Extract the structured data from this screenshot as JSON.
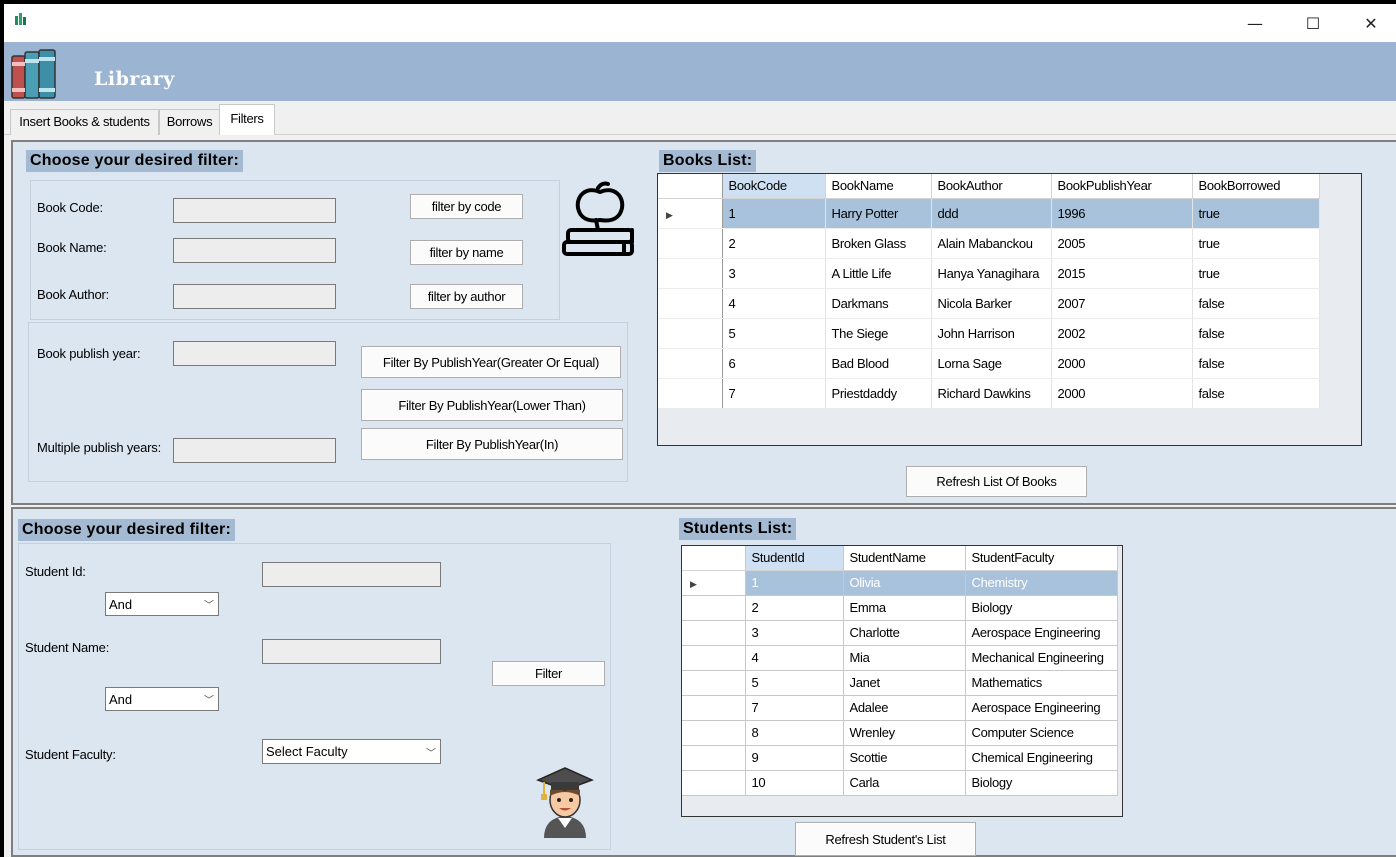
{
  "window": {
    "title": "Library",
    "minimize": "—",
    "maximize": "☐",
    "close": "✕"
  },
  "tabs": [
    {
      "label": "Insert Books & students",
      "active": false
    },
    {
      "label": "Borrows",
      "active": false
    },
    {
      "label": "Filters",
      "active": true
    }
  ],
  "books_filter": {
    "heading": "Choose your desired filter:",
    "book_code_label": "Book Code:",
    "book_name_label": "Book Name:",
    "book_author_label": "Book Author:",
    "filter_by_code": "filter by code",
    "filter_by_name": "filter by name",
    "filter_by_author": "filter by author",
    "publish_year_label": "Book publish year:",
    "multiple_years_label": "Multiple publish years:",
    "filter_year_gte": "Filter By PublishYear(Greater Or Equal)",
    "filter_year_lt": "Filter By PublishYear(Lower Than)",
    "filter_year_in": "Filter By PublishYear(In)"
  },
  "books_list": {
    "heading": "Books List:",
    "columns": [
      "BookCode",
      "BookName",
      "BookAuthor",
      "BookPublishYear",
      "BookBorrowed"
    ],
    "rows": [
      [
        "1",
        "Harry Potter",
        "ddd",
        "1996",
        "true"
      ],
      [
        "2",
        "Broken Glass",
        "Alain Mabanckou",
        "2005",
        "true"
      ],
      [
        "3",
        "A Little Life",
        "Hanya Yanagihara",
        "2015",
        "true"
      ],
      [
        "4",
        "Darkmans",
        "Nicola Barker",
        "2007",
        "false"
      ],
      [
        "5",
        "The Siege",
        "John Harrison",
        "2002",
        "false"
      ],
      [
        "6",
        "Bad Blood",
        "Lorna Sage",
        "2000",
        "false"
      ],
      [
        "7",
        "Priestdaddy",
        "Richard Dawkins",
        "2000",
        "false"
      ]
    ],
    "refresh_label": "Refresh List Of Books"
  },
  "students_filter": {
    "heading": "Choose your desired filter:",
    "student_id_label": "Student Id:",
    "student_name_label": "Student Name:",
    "student_faculty_label": "Student Faculty:",
    "operator_1": "And",
    "operator_2": "And",
    "faculty_select": "Select Faculty",
    "filter_label": "Filter"
  },
  "students_list": {
    "heading": "Students List:",
    "columns": [
      "StudentId",
      "StudentName",
      "StudentFaculty"
    ],
    "rows": [
      [
        "1",
        "Olivia",
        "Chemistry"
      ],
      [
        "2",
        "Emma",
        "Biology"
      ],
      [
        "3",
        "Charlotte",
        "Aerospace Engineering"
      ],
      [
        "4",
        "Mia",
        "Mechanical Engineering"
      ],
      [
        "5",
        "Janet",
        "Mathematics"
      ],
      [
        "7",
        "Adalee",
        "Aerospace Engineering"
      ],
      [
        "8",
        "Wrenley",
        "Computer Science"
      ],
      [
        "9",
        "Scottie",
        "Chemical Engineering"
      ],
      [
        "10",
        "Carla",
        "Biology"
      ]
    ],
    "refresh_label": "Refresh Student's List"
  },
  "icons": [
    "app-icon",
    "books-logo-icon",
    "apple-books-icon",
    "graduate-icon",
    "row-pointer-icon",
    "chevron-down-icon"
  ],
  "colors": {
    "header": "#9ab4d1",
    "panel": "#dbe6f1",
    "heading": "#a3bad2",
    "selected_row": "#a9c2dc"
  }
}
